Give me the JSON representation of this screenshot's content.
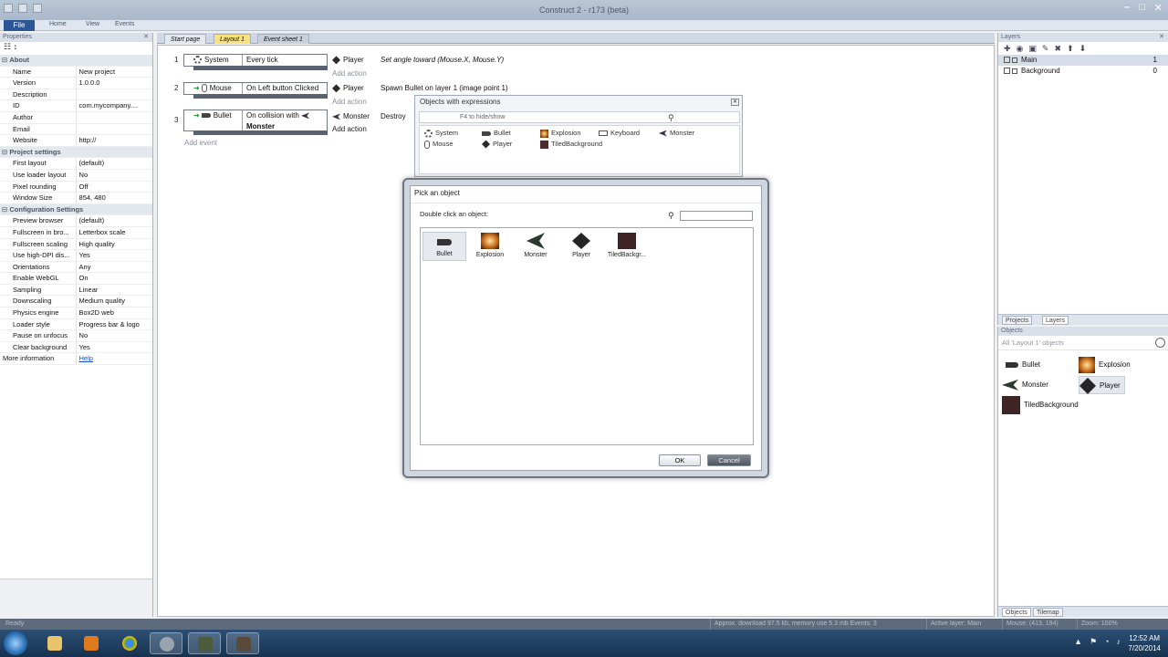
{
  "window": {
    "title": "Construct 2 - r173 (beta)"
  },
  "ribbon": {
    "file": "File",
    "tabs": [
      "Home",
      "View",
      "Events"
    ]
  },
  "properties": {
    "title": "Properties",
    "rows": [
      {
        "type": "cat",
        "k": "About"
      },
      {
        "k": "Name",
        "v": "New project"
      },
      {
        "k": "Version",
        "v": "1.0.0.0"
      },
      {
        "k": "Description",
        "v": ""
      },
      {
        "k": "ID",
        "v": "com.mycompany...."
      },
      {
        "k": "Author",
        "v": ""
      },
      {
        "k": "Email",
        "v": ""
      },
      {
        "k": "Website",
        "v": "http://"
      },
      {
        "type": "cat",
        "k": "Project settings"
      },
      {
        "k": "First layout",
        "v": "(default)"
      },
      {
        "k": "Use loader layout",
        "v": "No"
      },
      {
        "k": "Pixel rounding",
        "v": "Off"
      },
      {
        "k": "Window Size",
        "v": "854, 480"
      },
      {
        "type": "cat",
        "k": "Configuration Settings"
      },
      {
        "k": "Preview browser",
        "v": "(default)"
      },
      {
        "k": "Fullscreen in bro...",
        "v": "Letterbox scale"
      },
      {
        "k": "Fullscreen scaling",
        "v": "High quality"
      },
      {
        "k": "Use high-DPI dis...",
        "v": "Yes"
      },
      {
        "k": "Orientations",
        "v": "Any"
      },
      {
        "k": "Enable WebGL",
        "v": "On"
      },
      {
        "k": "Sampling",
        "v": "Linear"
      },
      {
        "k": "Downscaling",
        "v": "Medium quality"
      },
      {
        "k": "Physics engine",
        "v": "Box2D web"
      },
      {
        "k": "Loader style",
        "v": "Progress bar & logo"
      },
      {
        "k": "Pause on unfocus",
        "v": "No"
      },
      {
        "k": "Clear background",
        "v": "Yes"
      }
    ],
    "more_label": "More information",
    "help_link": "Help"
  },
  "doc_tabs": [
    "Start page",
    "Layout 1",
    "Event sheet 1"
  ],
  "events": [
    {
      "num": "1",
      "object": "System",
      "icon": "gear-icon",
      "condition": "Every tick",
      "action_object": "Player",
      "action_text": "Set angle toward (Mouse.X, Mouse.Y)"
    },
    {
      "num": "2",
      "object": "Mouse",
      "icon": "mouse-icon",
      "condition": "On Left button Clicked",
      "action_object": "Player",
      "action_text": "Spawn  Bullet on layer 1 (image point 1)"
    },
    {
      "num": "3",
      "object": "Bullet",
      "icon": "bullet-icon",
      "condition": "On collision with",
      "condition_target": "Monster",
      "action_object": "Monster",
      "action_text": "Destroy"
    }
  ],
  "add_action": "Add action",
  "add_event": "Add event",
  "expressions_window": {
    "title": "Objects with expressions",
    "search_hint": "F4 to hide/show",
    "items": [
      "System",
      "Bullet",
      "Explosion",
      "Keyboard",
      "Monster",
      "Mouse",
      "Player",
      "TiledBackground"
    ]
  },
  "pick_dialog": {
    "title": "Pick an object",
    "prompt": "Double click an object:",
    "search_value": "",
    "objects": [
      "Bullet",
      "Explosion",
      "Monster",
      "Player",
      "TiledBackgr..."
    ],
    "ok": "OK",
    "cancel": "Cancel"
  },
  "layers": {
    "title": "Layers",
    "rows": [
      {
        "name": "Main",
        "num": "1"
      },
      {
        "name": "Background",
        "num": "0"
      }
    ],
    "tabs": [
      "Projects",
      "Layers"
    ]
  },
  "objects_panel": {
    "title": "Objects",
    "filter": "All 'Layout 1' objects",
    "items": [
      "Bullet",
      "Explosion",
      "Monster",
      "Player",
      "TiledBackground"
    ],
    "tabs": [
      "Objects",
      "Tilemap"
    ]
  },
  "statusbar": {
    "left": "Ready",
    "mid": "Approx. download 97.5 kb, memory use 5.3 mb   Events: 3",
    "right1": "Active layer: Main",
    "right2": "Mouse: (413, 194)",
    "right3": "Zoom: 100%"
  },
  "clock": {
    "time": "12:52 AM",
    "date": "7/20/2014"
  }
}
